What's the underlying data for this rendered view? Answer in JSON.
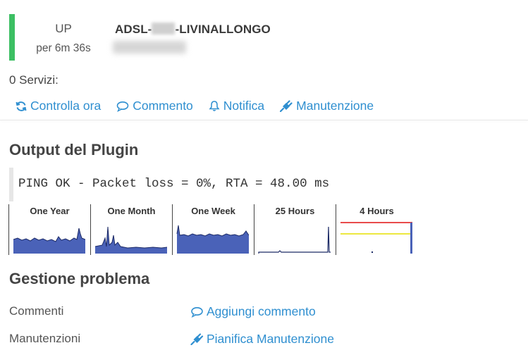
{
  "host": {
    "state": "UP",
    "duration": "per 6m 36s",
    "name_prefix": "ADSL-",
    "name_suffix": "-LIVINALLONGO",
    "accent_color": "#3cbf63"
  },
  "services_count": "0 Servizi:",
  "actions": [
    {
      "label": "Controlla ora",
      "icon": "refresh-icon"
    },
    {
      "label": "Commento",
      "icon": "comment-icon"
    },
    {
      "label": "Notifica",
      "icon": "bell-icon"
    },
    {
      "label": "Manutenzione",
      "icon": "plug-icon"
    }
  ],
  "plugin_output": {
    "title": "Output del Plugin",
    "text": "PING OK - Packet loss = 0%, RTA = 48.00 ms"
  },
  "graphs": [
    {
      "label": "One Year"
    },
    {
      "label": "One Month"
    },
    {
      "label": "One Week"
    },
    {
      "label": "25 Hours"
    },
    {
      "label": "4 Hours"
    }
  ],
  "problem_management": {
    "title": "Gestione problema",
    "rows": [
      {
        "label": "Commenti",
        "link": "Aggiungi commento",
        "icon": "comment-icon"
      },
      {
        "label": "Manutenzioni",
        "link": "Pianifica Manutenzione",
        "icon": "plug-icon"
      }
    ]
  },
  "colors": {
    "link": "#2f8fd0",
    "graph_fill": "#4a62b8",
    "threshold_warning": "#e6e000",
    "threshold_critical": "#e01010"
  }
}
